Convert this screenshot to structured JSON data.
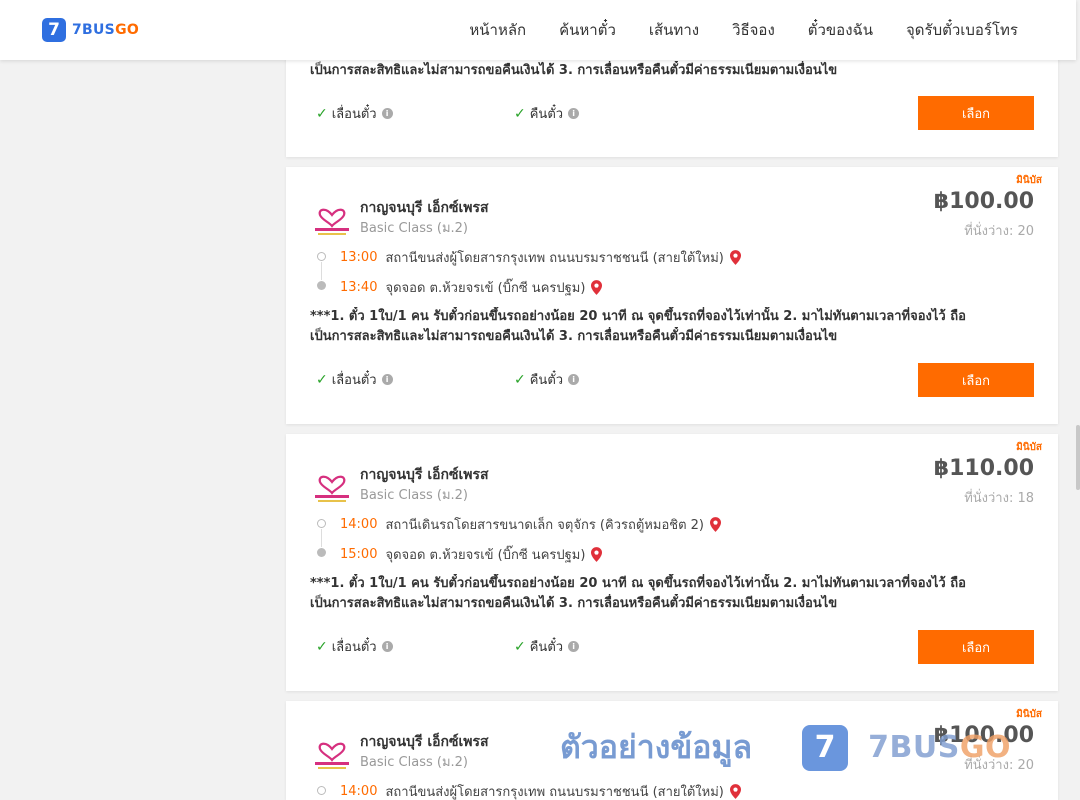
{
  "header": {
    "logo_mark": "7",
    "logo_text_main": "7BUS",
    "logo_text_accent": "GO",
    "nav": [
      "หน้าหลัก",
      "ค้นหาตั๋ว",
      "เส้นทาง",
      "วิธีจอง",
      "ตั๋วของฉัน",
      "จุดรับตั๋วเบอร์โทร"
    ]
  },
  "colors": {
    "accent": "#ff6b00",
    "brand": "#2f6fe0",
    "check": "#29a329",
    "pin": "#e0303a"
  },
  "top_card": {
    "cond_line2": "เป็นการสละสิทธิและไม่สามารถขอคืนเงินได้ 3. การเลื่อนหรือคืนตั๋วมีค่าธรรมเนียมตามเงื่อนไข",
    "opt_change": "เลื่อนตั๋ว",
    "opt_refund": "คืนตั๋ว",
    "select_label": "เลือก"
  },
  "trips": [
    {
      "tag": "มินิบัส",
      "operator": "กาญจนบุรี เอ็กซ์เพรส",
      "bus_class": "Basic Class (ม.2)",
      "price": "฿100.00",
      "seats": "ที่นั่งว่าง: 20",
      "depart_time": "13:00",
      "depart_place": "สถานีขนส่งผู้โดยสารกรุงเทพ ถนนบรมราชชนนี (สายใต้ใหม่)",
      "arrive_time": "13:40",
      "arrive_place": "จุดจอด ต.ห้วยจรเข้ (บิ๊กซี นครปฐม)",
      "cond_line1": "***1. ตั๋ว 1ใบ/1 คน รับตั๋วก่อนขึ้นรถอย่างน้อย 20 นาที ณ จุดขึ้นรถที่จองไว้เท่านั้น 2. มาไม่ทันตามเวลาที่จองไว้ ถือ",
      "cond_line2": "เป็นการสละสิทธิและไม่สามารถขอคืนเงินได้ 3. การเลื่อนหรือคืนตั๋วมีค่าธรรมเนียมตามเงื่อนไข",
      "opt_change": "เลื่อนตั๋ว",
      "opt_refund": "คืนตั๋ว",
      "select_label": "เลือก"
    },
    {
      "tag": "มินิบัส",
      "operator": "กาญจนบุรี เอ็กซ์เพรส",
      "bus_class": "Basic Class (ม.2)",
      "price": "฿110.00",
      "seats": "ที่นั่งว่าง: 18",
      "depart_time": "14:00",
      "depart_place": "สถานีเดินรถโดยสารขนาดเล็ก จตุจักร (คิวรถตู้หมอชิต 2)",
      "arrive_time": "15:00",
      "arrive_place": "จุดจอด ต.ห้วยจรเข้ (บิ๊กซี นครปฐม)",
      "cond_line1": "***1. ตั๋ว 1ใบ/1 คน รับตั๋วก่อนขึ้นรถอย่างน้อย 20 นาที ณ จุดขึ้นรถที่จองไว้เท่านั้น 2. มาไม่ทันตามเวลาที่จองไว้ ถือ",
      "cond_line2": "เป็นการสละสิทธิและไม่สามารถขอคืนเงินได้ 3. การเลื่อนหรือคืนตั๋วมีค่าธรรมเนียมตามเงื่อนไข",
      "opt_change": "เลื่อนตั๋ว",
      "opt_refund": "คืนตั๋ว",
      "select_label": "เลือก"
    },
    {
      "tag": "มินิบัส",
      "operator": "กาญจนบุรี เอ็กซ์เพรส",
      "bus_class": "Basic Class (ม.2)",
      "price": "฿100.00",
      "seats": "ที่นั่งว่าง: 20",
      "depart_time": "14:00",
      "depart_place": "สถานีขนส่งผู้โดยสารกรุงเทพ ถนนบรมราชชนนี (สายใต้ใหม่)"
    }
  ],
  "watermark": {
    "text": "ตัวอย่างข้อมูล",
    "badge": "7",
    "brand_main": "7BUS",
    "brand_accent": "GO"
  }
}
